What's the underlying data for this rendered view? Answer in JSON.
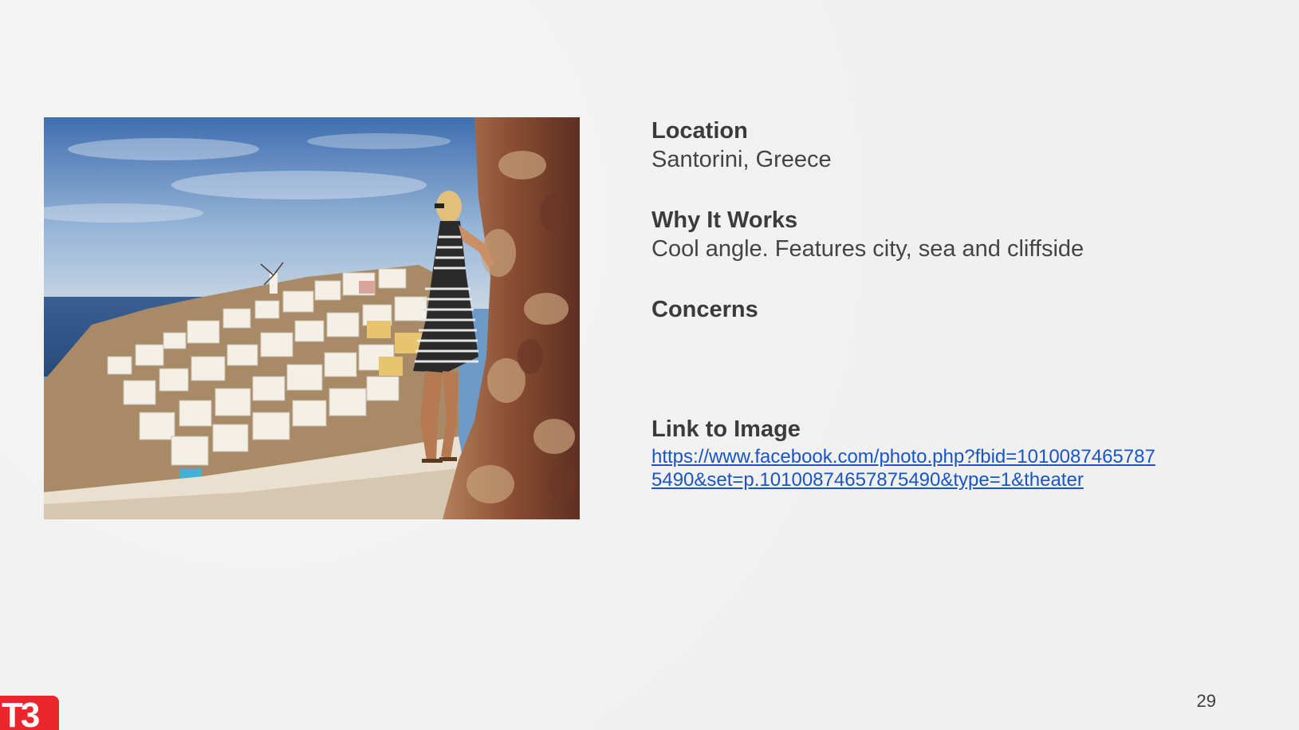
{
  "slide": {
    "location_label": "Location",
    "location_value": "Santorini, Greece",
    "why_label": "Why It Works",
    "why_value": "Cool angle. Features city, sea and cliffside",
    "concerns_label": "Concerns",
    "link_label": "Link to Image",
    "link_url": "https://www.facebook.com/photo.php?fbid=10100874657875490&set=p.10100874657875490&type=1&theater",
    "page_number": "29"
  },
  "logo": {
    "text": "T3",
    "color": "#e8262b"
  },
  "colors": {
    "link": "#1a55c4",
    "text": "#3d3d3d",
    "background": "#f0f0f0"
  }
}
